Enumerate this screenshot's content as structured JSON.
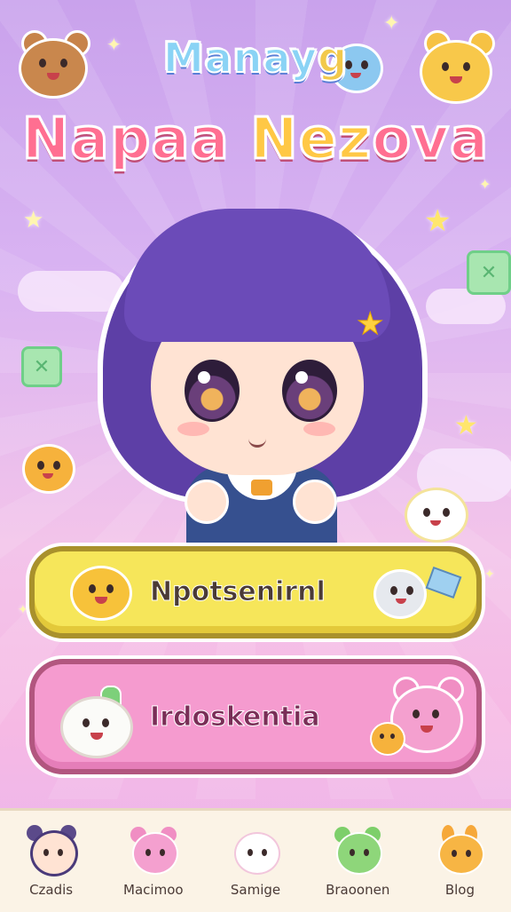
{
  "title": {
    "line1_main": "Manay",
    "line1_tail": "g",
    "line2_pre": "Napaa",
    "line2_mid": "Nez",
    "line2_post": "ova"
  },
  "buttons": {
    "primary_label": "Npotsenirnl",
    "secondary_label": "Irdoskentia"
  },
  "nav": {
    "items": [
      {
        "label": "Czadis",
        "icon": "girl-avatar-icon"
      },
      {
        "label": "Macimoo",
        "icon": "pink-bear-icon"
      },
      {
        "label": "Samige",
        "icon": "white-cat-icon"
      },
      {
        "label": "Braoonen",
        "icon": "green-frog-icon"
      },
      {
        "label": "Blog",
        "icon": "orange-bunny-icon"
      }
    ]
  },
  "colors": {
    "primary_button": "#f6e65a",
    "secondary_button": "#f59bcf",
    "background_top": "#c9a2ec",
    "background_bottom": "#f6b9e4",
    "nav_bar": "#fbf3e6"
  }
}
